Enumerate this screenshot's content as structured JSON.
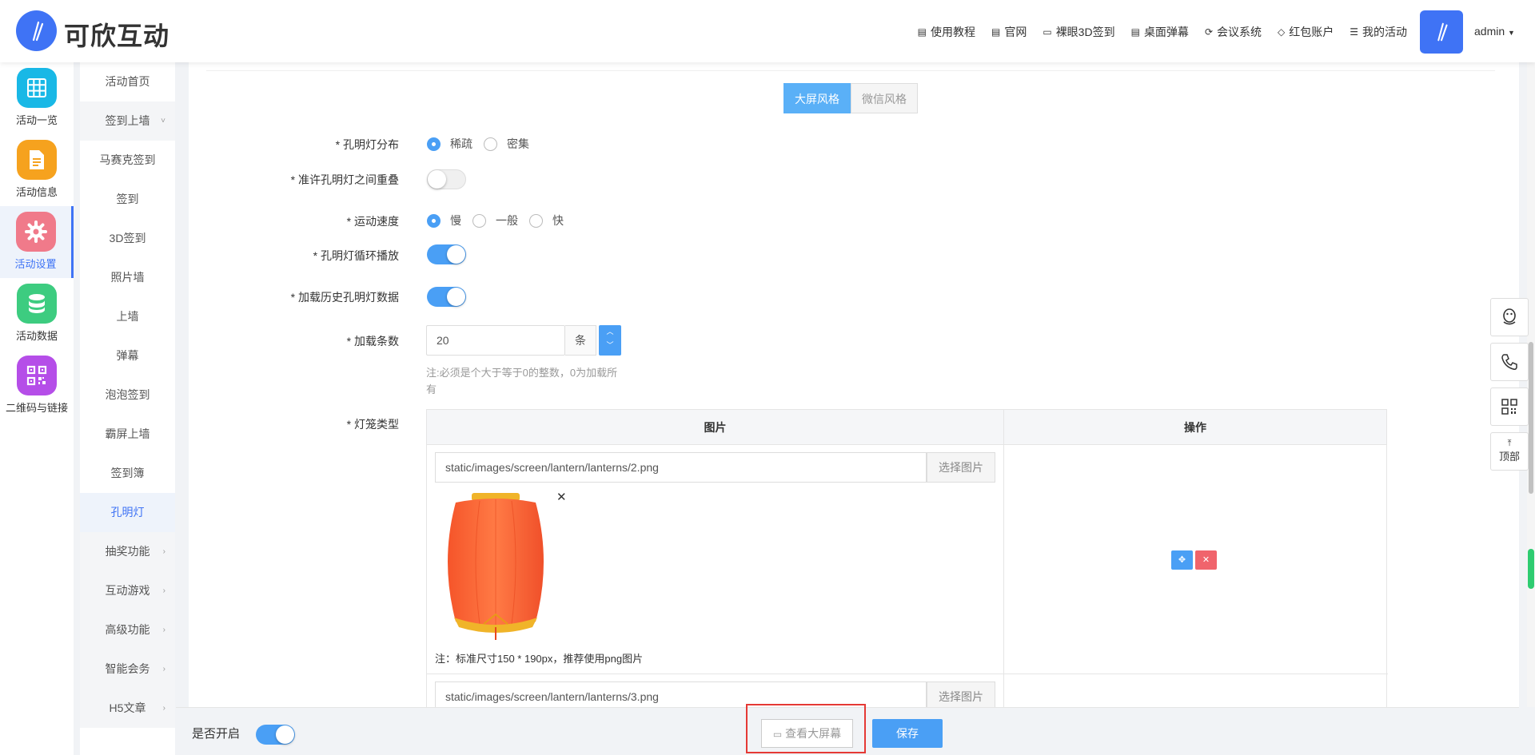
{
  "brand": {
    "name": "可欣互动"
  },
  "topnav": [
    {
      "label": "使用教程",
      "icon": "doc-icon"
    },
    {
      "label": "官网",
      "icon": "doc-icon"
    },
    {
      "label": "裸眼3D签到",
      "icon": "monitor-icon"
    },
    {
      "label": "桌面弹幕",
      "icon": "doc-icon"
    },
    {
      "label": "会议系统",
      "icon": "refresh-icon"
    },
    {
      "label": "红包账户",
      "icon": "diamond-icon"
    },
    {
      "label": "我的活动",
      "icon": "list-icon"
    }
  ],
  "user": {
    "name": "admin"
  },
  "iconbar": [
    {
      "label": "活动一览",
      "icon": "grid-icon",
      "color": "#19b8e6"
    },
    {
      "label": "活动信息",
      "icon": "document-icon",
      "color": "#f6a21e"
    },
    {
      "label": "活动设置",
      "icon": "gear-icon",
      "color": "#f07a8a",
      "active": true
    },
    {
      "label": "活动数据",
      "icon": "database-icon",
      "color": "#3dcc80"
    },
    {
      "label": "二维码与链接",
      "icon": "qrcode-icon",
      "color": "#b54ee8"
    }
  ],
  "submenu": [
    {
      "label": "活动首页"
    },
    {
      "label": "签到上墙",
      "chevron": "˅",
      "group": true
    },
    {
      "label": "马赛克签到"
    },
    {
      "label": "签到"
    },
    {
      "label": "3D签到"
    },
    {
      "label": "照片墙"
    },
    {
      "label": "上墙"
    },
    {
      "label": "弹幕"
    },
    {
      "label": "泡泡签到"
    },
    {
      "label": "霸屏上墙"
    },
    {
      "label": "签到簿"
    },
    {
      "label": "孔明灯",
      "active": true
    },
    {
      "label": "抽奖功能",
      "chevron": "›",
      "group": true
    },
    {
      "label": "互动游戏",
      "chevron": "›",
      "group": true
    },
    {
      "label": "高级功能",
      "chevron": "›",
      "group": true
    },
    {
      "label": "智能会务",
      "chevron": "›",
      "group": true
    },
    {
      "label": "H5文章",
      "chevron": "›",
      "group": true
    }
  ],
  "style_tabs": {
    "screen": "大屏风格",
    "wechat": "微信风格"
  },
  "form": {
    "distribution": {
      "label": "* 孔明灯分布",
      "options": [
        "稀疏",
        "密集"
      ],
      "selected": "稀疏"
    },
    "overlap": {
      "label": "* 准许孔明灯之间重叠",
      "on": false
    },
    "speed": {
      "label": "* 运动速度",
      "options": [
        "慢",
        "一般",
        "快"
      ],
      "selected": "慢"
    },
    "loop": {
      "label": "* 孔明灯循环播放",
      "on": true
    },
    "history": {
      "label": "* 加载历史孔明灯数据",
      "on": true
    },
    "count": {
      "label": "* 加载条数",
      "value": "20",
      "unit": "条",
      "note": "注:必须是个大于等于0的整数，0为加载所有"
    },
    "lantern_type": {
      "label": "* 灯笼类型"
    }
  },
  "lantern_table": {
    "headers": [
      "图片",
      "操作"
    ],
    "rows": [
      {
        "path": "static/images/screen/lantern/lanterns/2.png",
        "choose": "选择图片",
        "note": "注：标准尺寸150 * 190px，推荐使用png图片"
      },
      {
        "path": "static/images/screen/lantern/lanterns/3.png",
        "choose": "选择图片"
      }
    ]
  },
  "bottom": {
    "enable_label": "是否开启",
    "enabled": true,
    "preview": "查看大屏幕",
    "save": "保存"
  },
  "float": {
    "top_label": "顶部"
  },
  "colors": {
    "accent": "#4a9ff5",
    "brand": "#3f73f5",
    "danger": "#f0646c",
    "highlight": "#e53935"
  }
}
